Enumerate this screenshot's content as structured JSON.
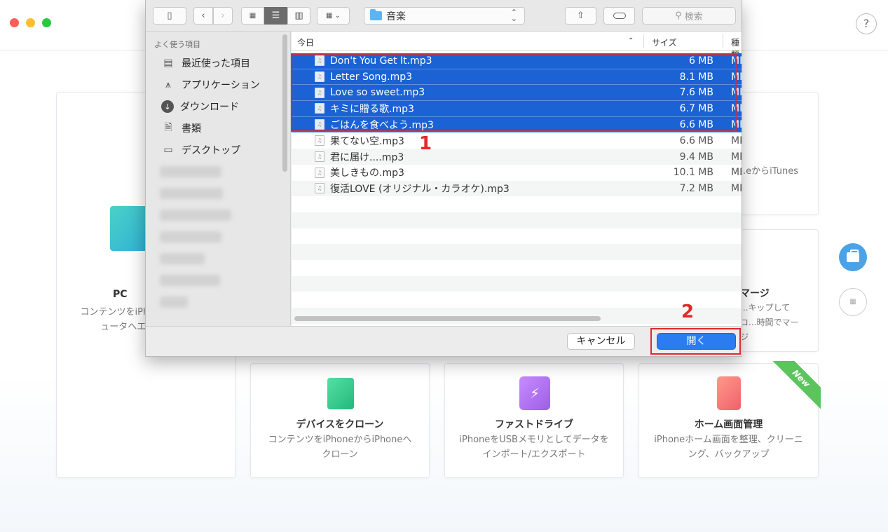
{
  "help_label": "?",
  "cards": {
    "pc_title": "PC",
    "pc_desc": "コンテンツをiPhoneからコンピュータへエクスポート",
    "itunes_desc": "...eからiTunes",
    "merge_title": "マージ",
    "merge_desc": "...キップしてコ...時間でマージ",
    "clone_title": "デバイスをクローン",
    "clone_desc": "コンテンツをiPhoneからiPhoneへクローン",
    "drive_title": "ファストドライブ",
    "drive_desc": "iPhoneをUSBメモリとしてデータをインポート/エクスポート",
    "home_title": "ホーム画面管理",
    "home_desc": "iPhoneホーム画面を整理、クリーニング、バックアップ",
    "new_badge": "New"
  },
  "dialog": {
    "path": "音楽",
    "search_placeholder": "検索",
    "sidebar": {
      "heading": "よく使う項目",
      "items": [
        {
          "label": "最近使った項目",
          "icon": "recents-icon"
        },
        {
          "label": "アプリケーション",
          "icon": "applications-icon"
        },
        {
          "label": "ダウンロード",
          "icon": "downloads-icon"
        },
        {
          "label": "書類",
          "icon": "documents-icon"
        },
        {
          "label": "デスクトップ",
          "icon": "desktop-icon"
        }
      ]
    },
    "columns": {
      "name": "今日",
      "size": "サイズ",
      "kind": "種類"
    },
    "files": [
      {
        "name": "Don't You Get It.mp3",
        "size": "6 MB",
        "kind": "MP",
        "selected": true
      },
      {
        "name": "Letter Song.mp3",
        "size": "8.1 MB",
        "kind": "MP",
        "selected": true
      },
      {
        "name": "Love so sweet.mp3",
        "size": "7.6 MB",
        "kind": "MP",
        "selected": true
      },
      {
        "name": "キミに贈る歌.mp3",
        "size": "6.7 MB",
        "kind": "MP",
        "selected": true
      },
      {
        "name": "ごはんを食べよう.mp3",
        "size": "6.6 MB",
        "kind": "MP",
        "selected": true
      },
      {
        "name": "果てない空.mp3",
        "size": "6.6 MB",
        "kind": "MP",
        "selected": false
      },
      {
        "name": "君に届け....mp3",
        "size": "9.4 MB",
        "kind": "MP",
        "selected": false
      },
      {
        "name": "美しきもの.mp3",
        "size": "10.1 MB",
        "kind": "MP",
        "selected": false
      },
      {
        "name": "復活LOVE (オリジナル・カラオケ).mp3",
        "size": "7.2 MB",
        "kind": "MP",
        "selected": false
      }
    ],
    "cancel_label": "キャンセル",
    "open_label": "開く"
  },
  "annotations": {
    "step1": "1",
    "step2": "2"
  },
  "colors": {
    "selection": "#1b62d4",
    "primary_button": "#2a7cf0",
    "annotation": "#e02a2a",
    "ribbon": "#5cc45c"
  }
}
